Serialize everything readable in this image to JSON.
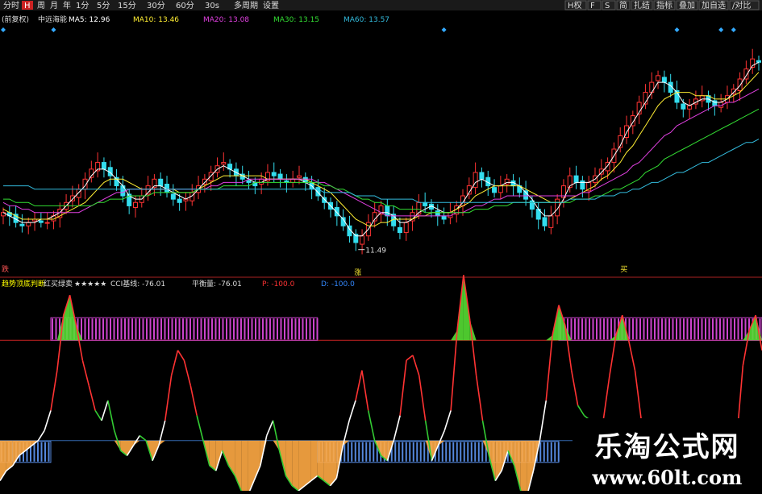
{
  "toolbar": {
    "left_items": [
      "分时",
      "H",
      "周",
      "月",
      "年",
      "1分",
      "5分",
      "15分",
      "30分",
      "60分",
      "30s",
      "多周期",
      "设置"
    ],
    "active_index": 1,
    "right_items": [
      "H权",
      "F",
      "S",
      "简",
      "扎结",
      "指标",
      "叠加",
      "加自选",
      "/对比"
    ]
  },
  "main_legend": {
    "items": [
      {
        "text": "(前复权)",
        "color": "#dddddd"
      },
      {
        "text": "中远海能",
        "color": "#dddddd"
      },
      {
        "text": "MA5: 12.96",
        "color": "#ffffff"
      },
      {
        "text": "MA10: 13.46",
        "color": "#ffee33"
      },
      {
        "text": "MA20: 13.08",
        "color": "#e040e0"
      },
      {
        "text": "MA30: 13.15",
        "color": "#33dd33"
      },
      {
        "text": "MA60: 13.57",
        "color": "#33bbdd"
      }
    ]
  },
  "annotations": {
    "low_price": "11.49",
    "low_mark": "涨",
    "mid_mark": "买",
    "left_mark": "跌"
  },
  "sub_legend": {
    "items": [
      {
        "text": "趋势顶底判断",
        "color": "#ffff00"
      },
      {
        "text": "红买绿卖",
        "color": "#dddddd"
      },
      {
        "text": "★★★★★",
        "color": "#dddddd"
      },
      {
        "text": "CCI基线: -76.01",
        "color": "#dddddd"
      },
      {
        "text": "平衡量: -76.01",
        "color": "#dddddd"
      },
      {
        "text": "P: -100.0",
        "color": "#ff3333"
      },
      {
        "text": "D: -100.0",
        "color": "#3388ff"
      }
    ]
  },
  "watermark": {
    "title": "乐淘公式网",
    "url": "www.60lt.com"
  },
  "colors": {
    "up": "#ff3333",
    "down": "#33ddee",
    "ma5": "#ffffff",
    "ma10": "#ffee33",
    "ma20": "#e040e0",
    "ma30": "#33dd33",
    "ma60": "#33bbdd",
    "purple_band": "#cc44cc",
    "blue_band": "#5588dd",
    "green_fill": "#55dd33",
    "orange_fill": "#ffaa44",
    "red_line": "#ff3333",
    "white_line": "#ffffff"
  },
  "chart_data": [
    {
      "type": "candlestick",
      "title": "中远海能",
      "ylim": [
        11.0,
        18.0
      ],
      "low_label": 11.49,
      "ma_last": {
        "MA5": 12.96,
        "MA10": 13.46,
        "MA20": 13.08,
        "MA30": 13.15,
        "MA60": 13.57
      },
      "close": [
        12.6,
        12.5,
        12.3,
        12.2,
        12.3,
        12.4,
        12.3,
        12.3,
        12.5,
        12.7,
        12.9,
        13.1,
        13.3,
        13.6,
        13.9,
        14.1,
        13.9,
        13.7,
        13.4,
        13.1,
        12.8,
        12.9,
        13.1,
        13.4,
        13.6,
        13.4,
        13.2,
        13.0,
        12.9,
        13.0,
        13.2,
        13.4,
        13.6,
        13.8,
        14.0,
        14.1,
        13.9,
        13.7,
        13.6,
        13.5,
        13.4,
        13.6,
        13.8,
        13.7,
        13.6,
        13.5,
        13.6,
        13.7,
        13.5,
        13.3,
        13.1,
        12.9,
        12.7,
        12.5,
        12.2,
        11.9,
        11.7,
        11.9,
        12.3,
        12.6,
        12.8,
        12.5,
        12.2,
        12.0,
        12.3,
        12.6,
        12.9,
        12.8,
        12.7,
        12.5,
        12.4,
        12.6,
        12.8,
        13.1,
        13.4,
        13.8,
        13.6,
        13.4,
        13.2,
        13.4,
        13.6,
        13.4,
        13.2,
        13.0,
        12.7,
        12.4,
        12.2,
        12.5,
        13.0,
        13.4,
        13.7,
        13.5,
        13.3,
        13.5,
        13.7,
        13.9,
        14.1,
        14.5,
        14.9,
        15.2,
        15.5,
        15.9,
        16.2,
        16.5,
        16.7,
        16.5,
        16.2,
        15.9,
        15.7,
        15.8,
        16.0,
        16.1,
        15.9,
        15.8,
        15.9,
        16.1,
        16.3,
        16.6,
        16.9,
        17.2,
        17.1
      ],
      "vol_series_note": "",
      "series": [
        {
          "name": "MA5",
          "values": [
            12.6,
            12.5,
            12.4,
            12.3,
            12.3,
            12.3,
            12.4,
            12.4,
            12.5,
            12.6,
            12.8,
            13.0,
            13.2,
            13.4,
            13.7,
            13.9,
            13.9,
            13.8,
            13.6,
            13.4,
            13.1,
            13.0,
            13.0,
            13.2,
            13.4,
            13.4,
            13.3,
            13.2,
            13.1,
            13.0,
            13.1,
            13.3,
            13.5,
            13.7,
            13.9,
            14.0,
            13.9,
            13.8,
            13.7,
            13.6,
            13.5,
            13.5,
            13.6,
            13.6,
            13.6,
            13.6,
            13.6,
            13.6,
            13.5,
            13.4,
            13.2,
            13.0,
            12.8,
            12.6,
            12.4,
            12.1,
            11.9,
            11.9,
            12.1,
            12.4,
            12.6,
            12.6,
            12.5,
            12.3,
            12.3,
            12.4,
            12.6,
            12.7,
            12.8,
            12.7,
            12.6,
            12.6,
            12.7,
            12.9,
            13.2,
            13.5,
            13.6,
            13.5,
            13.4,
            13.4,
            13.5,
            13.5,
            13.4,
            13.2,
            13.0,
            12.7,
            12.5,
            12.5,
            12.7,
            13.0,
            13.4,
            13.5,
            13.5,
            13.5,
            13.6,
            13.8,
            14.0,
            14.3,
            14.6,
            15.0,
            15.3,
            15.6,
            15.9,
            16.2,
            16.5,
            16.5,
            16.4,
            16.2,
            15.9,
            15.8,
            15.9,
            16.0,
            16.0,
            15.9,
            15.9,
            16.0,
            16.2,
            16.4,
            16.7,
            17.0,
            17.1
          ]
        },
        {
          "name": "MA10",
          "values": [
            12.7,
            12.6,
            12.5,
            12.4,
            12.4,
            12.4,
            12.4,
            12.4,
            12.4,
            12.5,
            12.6,
            12.7,
            12.8,
            12.9,
            13.1,
            13.3,
            13.5,
            13.6,
            13.6,
            13.6,
            13.5,
            13.4,
            13.3,
            13.3,
            13.3,
            13.3,
            13.3,
            13.3,
            13.2,
            13.2,
            13.2,
            13.3,
            13.4,
            13.5,
            13.6,
            13.7,
            13.7,
            13.7,
            13.7,
            13.7,
            13.7,
            13.7,
            13.6,
            13.6,
            13.6,
            13.6,
            13.6,
            13.6,
            13.6,
            13.5,
            13.4,
            13.3,
            13.2,
            13.0,
            12.8,
            12.6,
            12.4,
            12.3,
            12.2,
            12.2,
            12.3,
            12.3,
            12.4,
            12.4,
            12.4,
            12.4,
            12.5,
            12.5,
            12.6,
            12.6,
            12.6,
            12.6,
            12.7,
            12.8,
            12.9,
            13.1,
            13.2,
            13.3,
            13.4,
            13.4,
            13.4,
            13.4,
            13.4,
            13.3,
            13.2,
            13.1,
            13.0,
            12.9,
            12.9,
            12.9,
            13.0,
            13.1,
            13.2,
            13.3,
            13.4,
            13.6,
            13.7,
            13.9,
            14.1,
            14.4,
            14.6,
            14.9,
            15.2,
            15.5,
            15.8,
            16.0,
            16.1,
            16.2,
            16.2,
            16.2,
            16.1,
            16.1,
            16.1,
            16.0,
            16.0,
            16.0,
            16.1,
            16.2,
            16.4,
            16.6,
            16.8
          ]
        },
        {
          "name": "MA20",
          "values": [
            12.9,
            12.8,
            12.8,
            12.7,
            12.7,
            12.6,
            12.6,
            12.6,
            12.6,
            12.6,
            12.6,
            12.6,
            12.6,
            12.7,
            12.8,
            12.9,
            13.0,
            13.1,
            13.2,
            13.2,
            13.3,
            13.3,
            13.3,
            13.3,
            13.3,
            13.3,
            13.3,
            13.3,
            13.3,
            13.3,
            13.3,
            13.3,
            13.3,
            13.4,
            13.4,
            13.5,
            13.5,
            13.5,
            13.5,
            13.6,
            13.6,
            13.6,
            13.6,
            13.6,
            13.6,
            13.6,
            13.6,
            13.6,
            13.6,
            13.6,
            13.5,
            13.5,
            13.4,
            13.3,
            13.2,
            13.1,
            13.0,
            12.9,
            12.8,
            12.7,
            12.6,
            12.5,
            12.5,
            12.5,
            12.5,
            12.5,
            12.5,
            12.5,
            12.5,
            12.5,
            12.5,
            12.5,
            12.6,
            12.6,
            12.7,
            12.8,
            12.8,
            12.9,
            13.0,
            13.0,
            13.1,
            13.1,
            13.1,
            13.1,
            13.1,
            13.1,
            13.1,
            13.1,
            13.1,
            13.1,
            13.1,
            13.1,
            13.2,
            13.2,
            13.3,
            13.4,
            13.5,
            13.6,
            13.7,
            13.8,
            14.0,
            14.1,
            14.3,
            14.5,
            14.7,
            14.9,
            15.0,
            15.2,
            15.3,
            15.4,
            15.5,
            15.6,
            15.7,
            15.8,
            15.8,
            15.9,
            15.9,
            16.0,
            16.1,
            16.2,
            16.3
          ]
        },
        {
          "name": "MA30",
          "values": [
            13.0,
            13.0,
            12.9,
            12.9,
            12.9,
            12.8,
            12.8,
            12.8,
            12.8,
            12.8,
            12.8,
            12.8,
            12.8,
            12.8,
            12.8,
            12.9,
            12.9,
            13.0,
            13.0,
            13.0,
            13.1,
            13.1,
            13.1,
            13.1,
            13.2,
            13.2,
            13.2,
            13.2,
            13.2,
            13.2,
            13.2,
            13.3,
            13.3,
            13.3,
            13.3,
            13.4,
            13.4,
            13.4,
            13.4,
            13.4,
            13.5,
            13.5,
            13.5,
            13.5,
            13.5,
            13.5,
            13.5,
            13.5,
            13.5,
            13.5,
            13.5,
            13.4,
            13.4,
            13.3,
            13.3,
            13.2,
            13.1,
            13.0,
            13.0,
            12.9,
            12.9,
            12.8,
            12.8,
            12.7,
            12.7,
            12.7,
            12.7,
            12.6,
            12.6,
            12.6,
            12.6,
            12.6,
            12.6,
            12.6,
            12.6,
            12.7,
            12.7,
            12.7,
            12.8,
            12.8,
            12.8,
            12.9,
            12.9,
            12.9,
            12.9,
            12.9,
            12.9,
            12.9,
            12.9,
            12.9,
            12.9,
            13.0,
            13.0,
            13.0,
            13.1,
            13.1,
            13.2,
            13.3,
            13.3,
            13.4,
            13.5,
            13.6,
            13.8,
            13.9,
            14.0,
            14.2,
            14.3,
            14.4,
            14.5,
            14.6,
            14.7,
            14.8,
            14.9,
            15.0,
            15.1,
            15.2,
            15.3,
            15.4,
            15.5,
            15.6,
            15.7
          ]
        },
        {
          "name": "MA60",
          "values": [
            13.4,
            13.4,
            13.4,
            13.4,
            13.4,
            13.3,
            13.3,
            13.3,
            13.3,
            13.3,
            13.3,
            13.3,
            13.3,
            13.3,
            13.3,
            13.3,
            13.3,
            13.3,
            13.3,
            13.3,
            13.3,
            13.3,
            13.3,
            13.3,
            13.3,
            13.3,
            13.3,
            13.3,
            13.3,
            13.3,
            13.3,
            13.3,
            13.3,
            13.3,
            13.3,
            13.3,
            13.3,
            13.3,
            13.3,
            13.3,
            13.3,
            13.3,
            13.3,
            13.3,
            13.3,
            13.3,
            13.3,
            13.3,
            13.3,
            13.3,
            13.3,
            13.2,
            13.2,
            13.2,
            13.2,
            13.2,
            13.1,
            13.1,
            13.1,
            13.1,
            13.0,
            13.0,
            13.0,
            13.0,
            13.0,
            13.0,
            12.9,
            12.9,
            12.9,
            12.9,
            12.9,
            12.9,
            12.9,
            12.9,
            12.9,
            12.9,
            12.9,
            12.9,
            12.9,
            12.9,
            12.9,
            12.9,
            12.9,
            12.9,
            12.9,
            12.9,
            12.9,
            12.9,
            12.9,
            12.9,
            13.0,
            13.0,
            13.0,
            13.0,
            13.0,
            13.1,
            13.1,
            13.1,
            13.2,
            13.2,
            13.3,
            13.3,
            13.4,
            13.5,
            13.5,
            13.6,
            13.7,
            13.8,
            13.8,
            13.9,
            14.0,
            14.1,
            14.1,
            14.2,
            14.3,
            14.4,
            14.5,
            14.6,
            14.7,
            14.7,
            14.8
          ]
        }
      ]
    },
    {
      "type": "line",
      "title": "趋势顶底判断",
      "ylim": [
        -200,
        200
      ],
      "upper_threshold": 100,
      "lower_threshold": -100,
      "series": [
        {
          "name": "CCI",
          "values": [
            -180,
            -160,
            -150,
            -130,
            -120,
            -110,
            -100,
            -80,
            -40,
            40,
            150,
            190,
            130,
            60,
            10,
            -40,
            -60,
            -20,
            -80,
            -120,
            -130,
            -110,
            -90,
            -100,
            -140,
            -110,
            -60,
            30,
            80,
            60,
            10,
            -50,
            -100,
            -150,
            -160,
            -120,
            -150,
            -170,
            -200,
            -210,
            -180,
            -150,
            -90,
            -60,
            -120,
            -170,
            -190,
            -200,
            -190,
            -180,
            -170,
            -180,
            -190,
            -175,
            -110,
            -60,
            -20,
            40,
            -40,
            -100,
            -130,
            -140,
            -100,
            -50,
            60,
            70,
            30,
            -60,
            -140,
            -110,
            -80,
            -40,
            120,
            230,
            140,
            30,
            -60,
            -130,
            -180,
            -160,
            -120,
            -150,
            -200,
            -210,
            -160,
            -100,
            -20,
            110,
            170,
            130,
            40,
            -30,
            -50,
            -60,
            -100,
            -60,
            30,
            110,
            150,
            100,
            40,
            -60,
            -130,
            -150,
            -170,
            -130,
            -160,
            -100,
            -130,
            -170,
            -150,
            -100,
            -120,
            -120,
            -200,
            -160,
            -100,
            50,
            120,
            150,
            80
          ]
        }
      ]
    }
  ]
}
